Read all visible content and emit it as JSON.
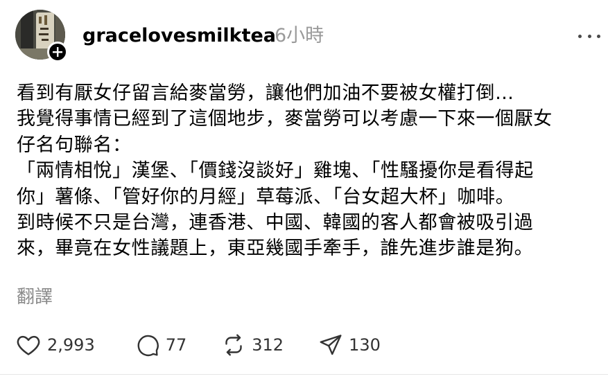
{
  "post": {
    "author": {
      "username": "gracelovesmilktea",
      "avatar_icon": "avatar-photo",
      "follow_icon": "plus-icon"
    },
    "timestamp": "6小時",
    "more_icon": "more-horizontal-icon",
    "text_lines": [
      "看到有厭女仔留言給麥當勞，讓他們加油不要被女權打倒…",
      "我覺得事情已經到了這個地步，麥當勞可以考慮一下來一個厭女",
      "仔名句聯名：",
      "「兩情相悅」漢堡、「價錢沒談好」雞塊、「性騷擾你是看得起",
      "你」薯條、「管好你的月經」草莓派、「台女超大杯」咖啡。",
      "到時候不只是台灣，連香港、中國、韓國的客人都會被吸引過",
      "來，畢竟在女性議題上，東亞幾國手牽手，誰先進步誰是狗。"
    ],
    "translate_label": "翻譯",
    "actions": {
      "likes": "2,993",
      "comments": "77",
      "reposts": "312",
      "shares": "130"
    },
    "colors": {
      "text": "#000000",
      "muted": "#999999",
      "icon": "#333333"
    }
  }
}
